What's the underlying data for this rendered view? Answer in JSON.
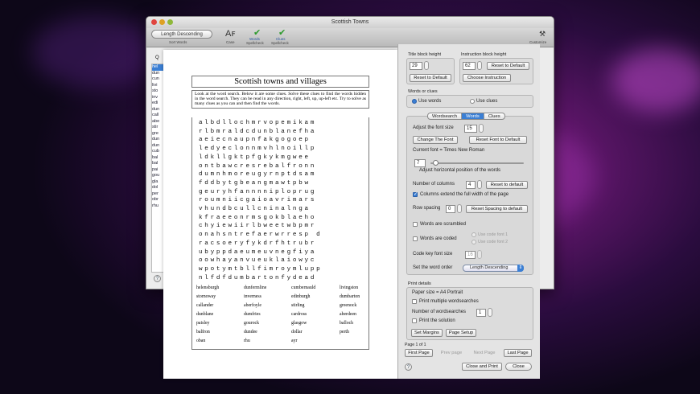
{
  "window": {
    "title": "Scottish Towns"
  },
  "toolbar": {
    "sort_value": "Length Descending",
    "sort_caption": "Sort Words",
    "case_caption": "Case",
    "words_caption": "Words",
    "words_sub": "Spellcheck",
    "clues_caption": "Clues",
    "clues_sub": "Spellcheck",
    "customize_caption": "Customize"
  },
  "sidebar": {
    "search_hint": "Q",
    "items": [
      "hel",
      "dun",
      "cun",
      "livi",
      "sto",
      "inv",
      "edi",
      "dun",
      "call",
      "abe",
      "stir",
      "gre",
      "dun",
      "dun",
      "cub",
      "bal",
      "bal",
      "pai",
      "gou",
      "gla",
      "dol",
      "per",
      "obr",
      "rhu"
    ],
    "help_label": "?"
  },
  "preview": {
    "title": "Scottish towns and villages",
    "instructions": "Look at the word search. Below it are some clues. Solve these clues to find the words hidden in the word search. They can be read in any direction, right, left, up, up-left etc. Try to solve as many clues as you can and then find the words.",
    "grid": [
      "albdllochmrvopemikam",
      "rlbmraldcdunblanefha",
      "aeiecnaupnfakgogoep",
      "ledyeclonnmvhlnoillp",
      "ldkllgktpfgkykmgwee",
      "ontbawcresrebalfronn",
      "dumnhmoreugyrnptdsam",
      "fddbytgbeangmawtpbw",
      "geuryhfannnniploprug",
      "roumniicgaioavrimars",
      "vhundbcullcninalnga",
      "kfraeeonrmsgokblaeho",
      "chyiewiirlbweetwbpmr",
      "onahsntrefaerwrresp d",
      "racsoeryfykdrfhtrubr",
      "ubyppdaeumeuvnegfiya",
      "oowhayanvueuklaiowyc",
      "wpotymtbllfimroymlupp",
      "nlfdfdumbartonfydead"
    ],
    "words": [
      [
        "helensburgh",
        "dunfermline",
        "cumbernauld",
        "livingston"
      ],
      [
        "stornoway",
        "inverness",
        "edinburgh",
        "dumbarton"
      ],
      [
        "callander",
        "aberfoyle",
        "stirling",
        "greenock"
      ],
      [
        "dunblane",
        "dumfries",
        "cardross",
        "aberdeen"
      ],
      [
        "paisley",
        "gourock",
        "glasgow",
        "balloch"
      ],
      [
        "balfron",
        "dundee",
        "dollar",
        "perth"
      ],
      [
        "oban",
        "rhu",
        "ayr",
        ""
      ]
    ]
  },
  "panel": {
    "title_block_height_label": "Title block height",
    "title_block_height_value": "29",
    "reset_default_1": "Reset to Default",
    "instruction_block_height_label": "Instruction block height",
    "instruction_block_height_value": "62",
    "reset_default_2": "Reset to Default",
    "choose_instruction": "Choose Instruction",
    "words_or_clues_label": "Words or clues",
    "use_words": "Use words",
    "use_clues": "Use clues",
    "tabs": [
      "Wordsearch",
      "Words",
      "Clues"
    ],
    "font_size_label": "Adjust the font size",
    "font_size_value": "15",
    "change_font": "Change The Font",
    "reset_font": "Reset Font to Default",
    "current_font": "Current font = Times New Roman",
    "hpos_value": "7",
    "hpos_label": "Adjust horizontal position of the words",
    "columns_label": "Number of columns",
    "columns_value": "4",
    "reset_to_default": "Reset to default",
    "columns_extend": "Columns extend the full width of the page",
    "row_spacing_label": "Row spacing",
    "row_spacing_value": "0",
    "reset_spacing": "Reset Spacing to default",
    "scrambled": "Words are scrambled",
    "coded": "Words are coded",
    "code_font_1": "Use code font 1",
    "code_font_2": "Use code font 2",
    "code_key_label": "Code key font size",
    "code_key_value": "16",
    "word_order_label": "Set the word order",
    "word_order_value": "Length Descending",
    "print_details_label": "Print details",
    "paper_size": "Paper size = A4 Portrait",
    "print_multiple": "Print multiple wordsearches",
    "num_ws_label": "Number of wordsearches",
    "num_ws_value": "1",
    "print_solution": "Print the solution",
    "set_margins": "Set Margins",
    "page_setup": "Page Setup",
    "page_indicator": "Page 1 of 1",
    "first_page": "First Page",
    "prev_page": "Prev page",
    "next_page": "Next Page",
    "last_page": "Last Page",
    "help": "?",
    "close_print": "Close and Print",
    "close": "Close"
  }
}
